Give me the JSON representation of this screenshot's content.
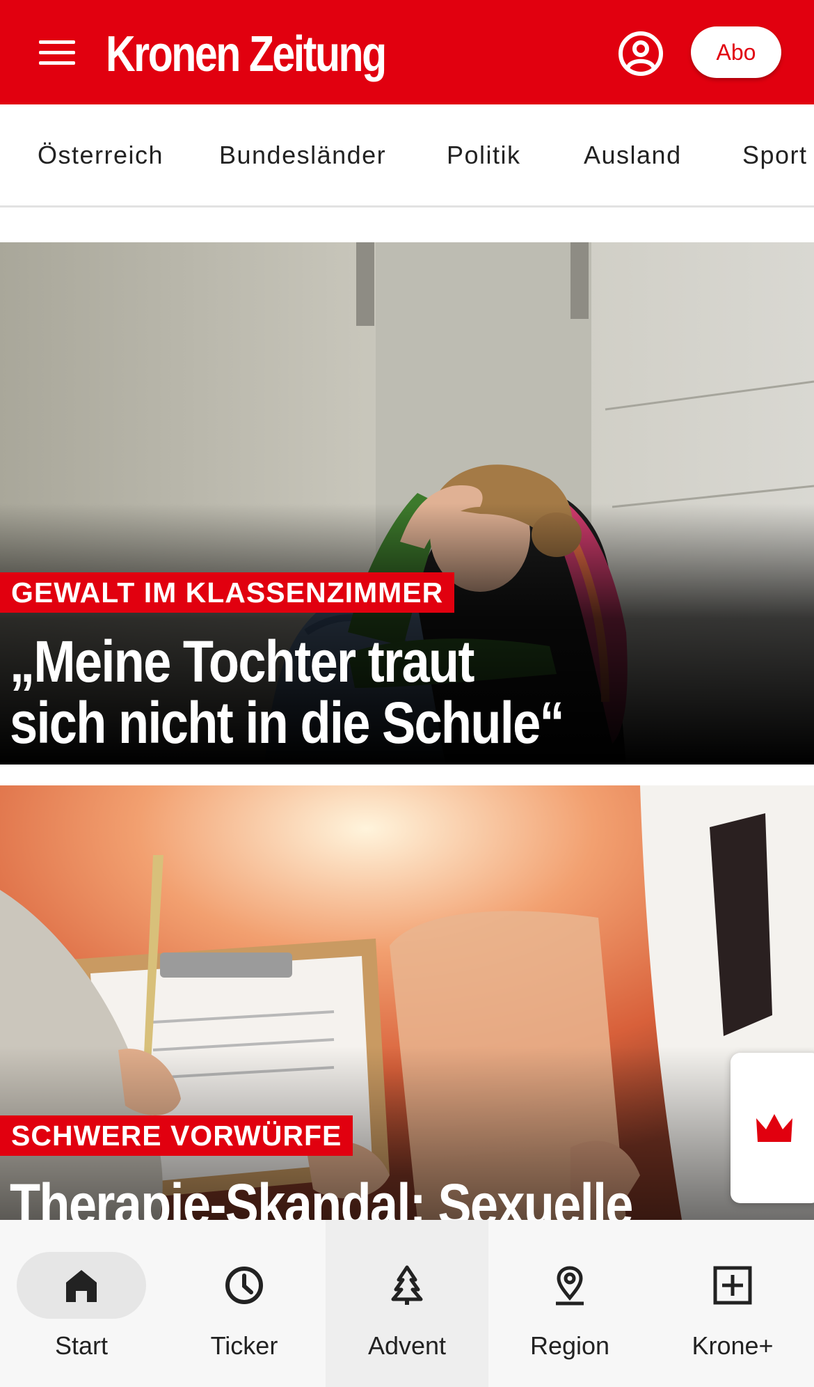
{
  "header": {
    "logo_text": "Kronen Zeitung",
    "abo_label": "Abo",
    "brand_color": "#e1000f",
    "icons": {
      "menu": "hamburger-menu-icon",
      "account": "user-circle-icon"
    }
  },
  "sections": [
    {
      "label": "Österreich"
    },
    {
      "label": "Bundesländer"
    },
    {
      "label": "Politik"
    },
    {
      "label": "Ausland"
    },
    {
      "label": "Sport"
    }
  ],
  "articles": [
    {
      "kicker": "GEWALT IM KLASSENZIMMER",
      "headline_line1": "„Meine Tochter traut",
      "headline_line2": "sich nicht in die Schule“"
    },
    {
      "kicker": "SCHWERE VORWÜRFE",
      "headline_line1": "Therapie-Skandal: Sexuelle"
    }
  ],
  "bottom_nav": [
    {
      "label": "Start",
      "icon": "home-icon",
      "selected": true
    },
    {
      "label": "Ticker",
      "icon": "clock-icon"
    },
    {
      "label": "Advent",
      "icon": "christmas-tree-icon"
    },
    {
      "label": "Region",
      "icon": "location-pin-icon"
    },
    {
      "label": "Krone+",
      "icon": "plus-box-icon"
    }
  ],
  "floating_widget": {
    "icon": "crown-icon"
  }
}
